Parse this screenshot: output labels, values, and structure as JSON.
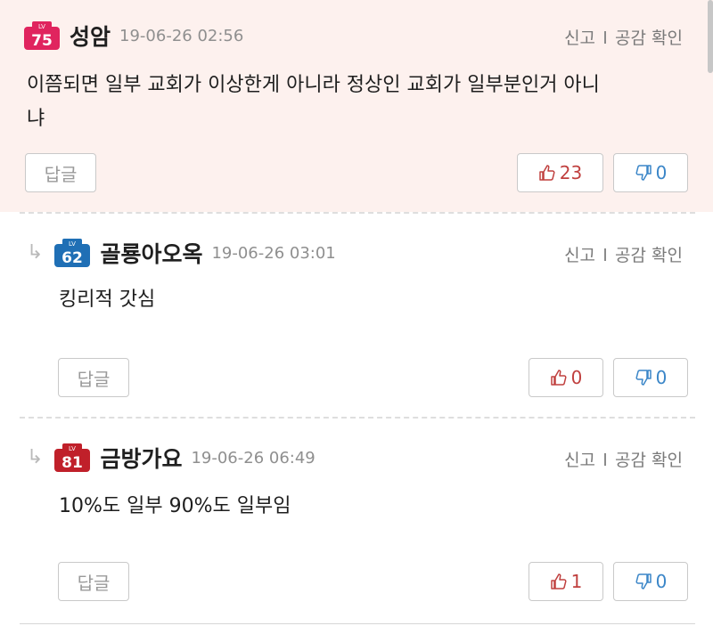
{
  "comments": [
    {
      "level": "75",
      "level_tag": "LV",
      "level_color": "#e0245e",
      "nickname": "성암",
      "date": "19-06-26 02:56",
      "report": "신고",
      "empathy": "공감 확인",
      "text_line1": "이쯤되면 일부 교회가 이상한게 아니라 정상인 교회가 일부분인거 아니",
      "text_line2": "냐",
      "reply_label": "답글",
      "likes": "23",
      "dislikes": "0",
      "is_reply": false
    },
    {
      "level": "62",
      "level_tag": "LV",
      "level_color": "#1f6fb5",
      "nickname": "골룡아오옥",
      "date": "19-06-26 03:01",
      "report": "신고",
      "empathy": "공감 확인",
      "text_line1": "킹리적 갓심",
      "reply_label": "답글",
      "likes": "0",
      "dislikes": "0",
      "is_reply": true
    },
    {
      "level": "81",
      "level_tag": "LV",
      "level_color": "#c0202a",
      "nickname": "금방가요",
      "date": "19-06-26 06:49",
      "report": "신고",
      "empathy": "공감 확인",
      "text_line1": "10%도 일부 90%도 일부임",
      "reply_label": "답글",
      "likes": "1",
      "dislikes": "0",
      "is_reply": true
    }
  ],
  "colors": {
    "highlight_bg": "#fdf1ee",
    "like": "#c0403f",
    "dislike": "#3b86c8"
  },
  "icons": {
    "reply_arrow": "reply-arrow-icon",
    "like": "thumbs-up-icon",
    "dislike": "thumbs-down-icon"
  }
}
